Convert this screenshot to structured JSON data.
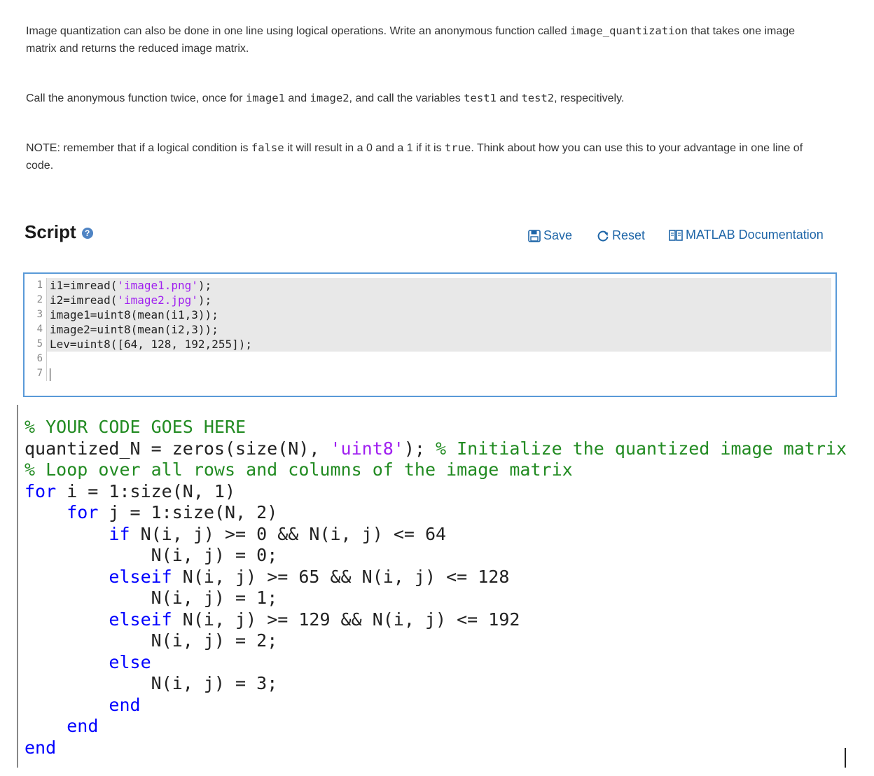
{
  "instructions": {
    "p1_a": "Image quantization can also be done in one line using logical operations.  Write an anonymous function called ",
    "p1_code": "image_quantization",
    "p1_b": " that takes one image matrix and returns the reduced image matrix.",
    "p2_a": "Call the anonymous function twice, once for ",
    "p2_code1": "image1",
    "p2_b": " and ",
    "p2_code2": "image2",
    "p2_c": ", and call the variables ",
    "p2_code3": "test1",
    "p2_d": " and ",
    "p2_code4": "test2",
    "p2_e": ", respecitively.",
    "p3_a": "NOTE: remember that if a logical condition is ",
    "p3_code1": "false",
    "p3_b": " it will result in a 0 and a 1 if it is ",
    "p3_code2": "true",
    "p3_c": ".  Think about how you can use this to your advantage in one line of code."
  },
  "script": {
    "title": "Script",
    "help_glyph": "?",
    "save_label": "Save",
    "reset_label": "Reset",
    "doc_label": "MATLAB Documentation"
  },
  "editor": {
    "lines": [
      {
        "num": "1",
        "pre": "i1=imread(",
        "str": "'image1.png'",
        "post": ");"
      },
      {
        "num": "2",
        "pre": "i2=imread(",
        "str": "'image2.jpg'",
        "post": ");"
      },
      {
        "num": "3",
        "pre": "image1=uint8(mean(i1,3));",
        "str": "",
        "post": ""
      },
      {
        "num": "4",
        "pre": "image2=uint8(mean(i2,3));",
        "str": "",
        "post": ""
      },
      {
        "num": "5",
        "pre": "Lev=uint8([64, 128, 192,255]);",
        "str": "",
        "post": ""
      },
      {
        "num": "6",
        "pre": "",
        "str": "",
        "post": ""
      },
      {
        "num": "7",
        "pre": "",
        "str": "",
        "post": ""
      }
    ]
  },
  "pasted_code": {
    "l1_cm": "% YOUR CODE GOES HERE",
    "l2_a": "quantized_N = zeros(size(N), ",
    "l2_st": "'uint8'",
    "l2_b": "); ",
    "l2_cm": "% Initialize the quantized image matrix",
    "l3_cm": "% Loop over all rows and columns of the image matrix",
    "l4_kw": "for",
    "l4_b": " i = 1:size(N, 1)",
    "l5_kw": "for",
    "l5_b": " j = 1:size(N, 2)",
    "l6_kw": "if",
    "l6_b": " N(i, j) >= 0 && N(i, j) <= 64",
    "l7": "N(i, j) = 0;",
    "l8_kw": "elseif",
    "l8_b": " N(i, j) >= 65 && N(i, j) <= 128",
    "l9": "N(i, j) = 1;",
    "l10_kw": "elseif",
    "l10_b": " N(i, j) >= 129 && N(i, j) <= 192",
    "l11": "N(i, j) = 2;",
    "l12_kw": "else",
    "l13": "N(i, j) = 3;",
    "l14_kw": "end",
    "l15_kw": "end",
    "l16_kw": "end"
  },
  "colors": {
    "accent": "#1f66a8",
    "editor_border": "#5a9ad8",
    "keyword": "#0000ff",
    "comment": "#228b22",
    "string": "#a020f0"
  }
}
